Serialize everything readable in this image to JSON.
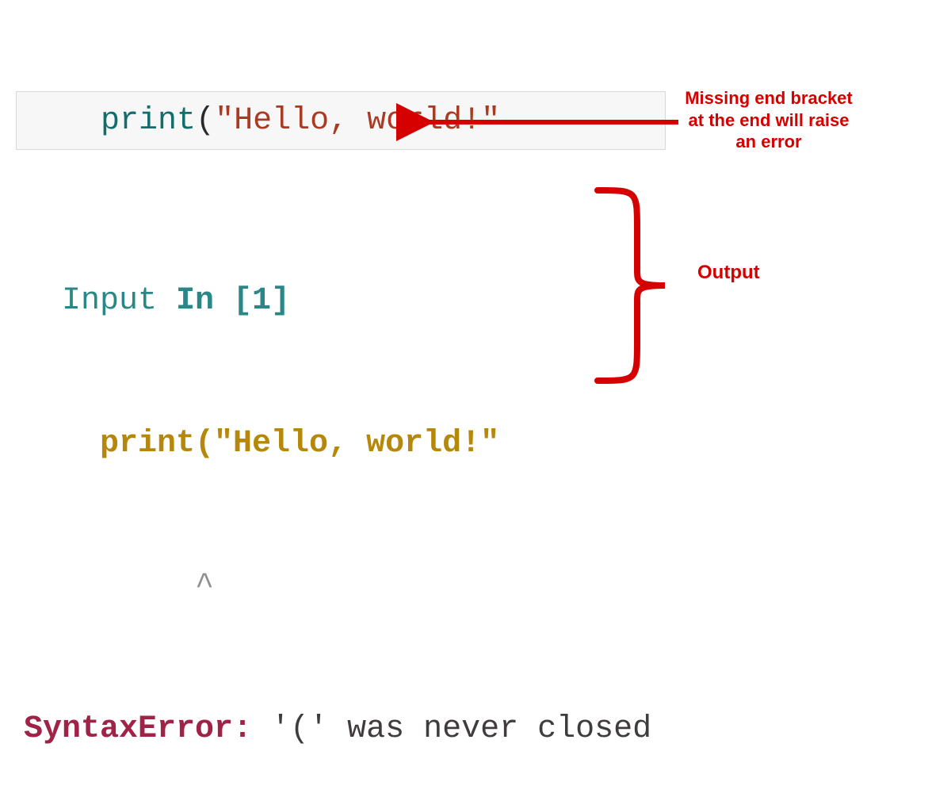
{
  "cell": {
    "code": {
      "func": "print",
      "open_paren": "(",
      "string": "\"Hello, world!\""
    }
  },
  "output": {
    "header_prefix": "  Input ",
    "header_bold": "In [1]",
    "echo_line": "    print(\"Hello, world!\"",
    "caret_line": "         ^",
    "error_type": "SyntaxError:",
    "error_msg": " '(' was never closed"
  },
  "annotations": {
    "missing_bracket": "Missing end bracket at the end will raise an error",
    "output_label": "Output"
  },
  "colors": {
    "annotation": "#d50000"
  }
}
